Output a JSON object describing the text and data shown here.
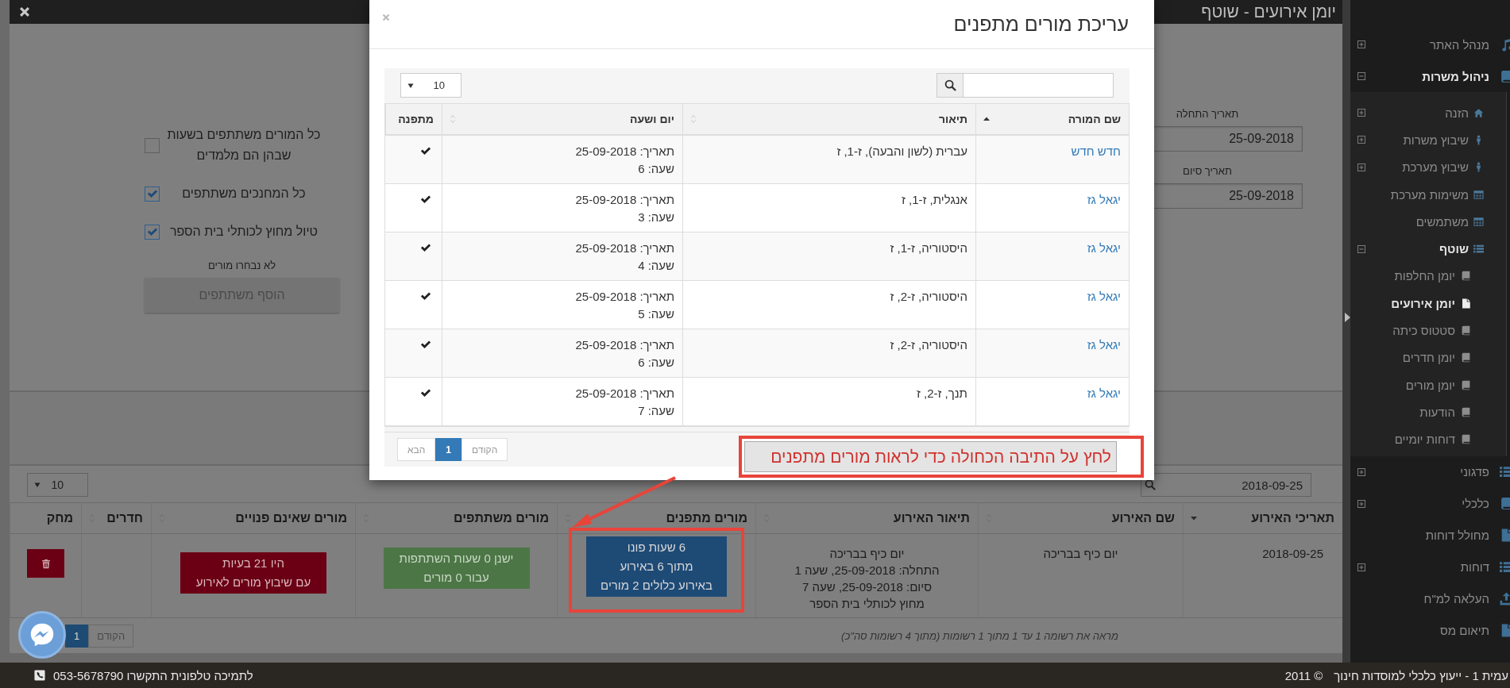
{
  "sidebar": {
    "items": [
      {
        "label": "מנהל האתר",
        "expanded": false,
        "selected": false
      },
      {
        "label": "ניהול משרות",
        "expanded": true,
        "selected": false,
        "children": [
          {
            "label": "הזנה",
            "expanded": false,
            "selected": false
          },
          {
            "label": "שיבוץ משרות",
            "expanded": false,
            "selected": false
          },
          {
            "label": "שיבוץ מערכת",
            "expanded": false,
            "selected": false
          },
          {
            "label": "משימות מערכת",
            "selected": false
          },
          {
            "label": "משתמשים",
            "selected": false
          },
          {
            "label": "שוטף",
            "expanded": true,
            "selected": false,
            "children": [
              {
                "label": "יומן החלפות",
                "selected": false
              },
              {
                "label": "יומן אירועים",
                "selected": true
              },
              {
                "label": "סטטוס כיתה",
                "selected": false
              },
              {
                "label": "יומן חדרים",
                "selected": false
              },
              {
                "label": "יומן מורים",
                "selected": false
              },
              {
                "label": "הודעות",
                "selected": false
              },
              {
                "label": "דוחות יומיים",
                "selected": false
              }
            ]
          }
        ]
      },
      {
        "label": "פדגוני",
        "expanded": false,
        "selected": false
      },
      {
        "label": "כלכלי",
        "expanded": false,
        "selected": false
      },
      {
        "label": "מחולל דוחות",
        "selected": false
      },
      {
        "label": "דוחות",
        "expanded": false,
        "selected": false
      },
      {
        "label": "העלאה למ\"ח",
        "selected": false
      },
      {
        "label": "תיאום מס",
        "selected": false
      }
    ]
  },
  "page": {
    "title": "יומן אירועים - שוטף"
  },
  "event_form": {
    "start_date": {
      "label": "תאריך התחלה",
      "value": "25-09-2018"
    },
    "end_date": {
      "label": "תאריך סיום",
      "value": "25-09-2018"
    },
    "options": [
      {
        "label": "כל המורים משתתפים בשעות שבהן הם מלמדים",
        "checked": false
      },
      {
        "label": "כל המחנכים משתתפים",
        "checked": true
      },
      {
        "label": "טיול מחוץ לכותלי בית הספר",
        "checked": true
      }
    ],
    "teachers_note": "לא נבחרו מורים",
    "add_button": {
      "label": "הוסף משתתפים",
      "disabled": true
    }
  },
  "events_table": {
    "page_size": "10",
    "search": "2018-09-25",
    "columns": [
      {
        "label": "תאריכי האירוע",
        "sortable": true,
        "sorted": true,
        "ascending": false
      },
      {
        "label": "שם האירוע",
        "sortable": true,
        "sorted": false
      },
      {
        "label": "תיאור האירוע",
        "sortable": true,
        "sorted": false
      },
      {
        "label": "מורים מתפנים",
        "sortable": true,
        "sorted": false
      },
      {
        "label": "מורים משתתפים",
        "sortable": true,
        "sorted": false
      },
      {
        "label": "מורים שאינם פנויים",
        "sortable": true,
        "sorted": false
      },
      {
        "label": "חדרים",
        "sortable": true,
        "sorted": false
      },
      {
        "label": "מחק",
        "sortable": false,
        "sorted": false
      }
    ],
    "rows": [
      {
        "date": "2018-09-25",
        "name": "יום כיף בבריכה",
        "description": [
          "יום כיף בבריכה",
          "התחלה: 25-09-2018, שעה 1",
          "סיום: 25-09-2018, שעה 7",
          "מחוץ לכותלי בית הספר"
        ],
        "freed": [
          "6 שעות פונו",
          "מתוך 6 באירוע",
          "באירוע כלולים 2 מורים"
        ],
        "participating": [
          "ישנן 0 שעות השתתפות",
          "עבור 0 מורים"
        ],
        "unavailable": [
          "היו 21 בעיות",
          "עם שיבוץ מורים לאירוע"
        ]
      }
    ],
    "info": "מראה את רשומה 1 עד 1 מתוך 1 רשומות (מתוך 4 רשומות סה\"כ)",
    "pagination": [
      {
        "label": "הקודם",
        "selected": false
      },
      {
        "label": "1",
        "selected": true
      }
    ]
  },
  "modal": {
    "title": "עריכת מורים מתפנים",
    "page_size": "10",
    "columns": [
      {
        "label": "שם המורה",
        "sortable": true,
        "sorted": true,
        "ascending": true
      },
      {
        "label": "תיאור",
        "sortable": true,
        "sorted": false
      },
      {
        "label": "יום ושעה",
        "sortable": true,
        "sorted": false
      },
      {
        "label": "מתפנה",
        "sortable": false,
        "sorted": false
      }
    ],
    "rows": [
      {
        "teacher": "חדש חדש",
        "description": "עברית (לשון והבעה), ז-1, ז",
        "date": "תאריך: 25-09-2018",
        "hour": "שעה: 6",
        "freed": true
      },
      {
        "teacher": "יגאל גז",
        "description": "אנגלית, ז-1, ז",
        "date": "תאריך: 25-09-2018",
        "hour": "שעה: 3",
        "freed": true
      },
      {
        "teacher": "יגאל גז",
        "description": "היסטוריה, ז-1, ז",
        "date": "תאריך: 25-09-2018",
        "hour": "שעה: 4",
        "freed": true
      },
      {
        "teacher": "יגאל גז",
        "description": "היסטוריה, ז-2, ז",
        "date": "תאריך: 25-09-2018",
        "hour": "שעה: 5",
        "freed": true
      },
      {
        "teacher": "יגאל גז",
        "description": "היסטוריה, ז-2, ז",
        "date": "תאריך: 25-09-2018",
        "hour": "שעה: 6",
        "freed": true
      },
      {
        "teacher": "יגאל גז",
        "description": "תנך, ז-2, ז",
        "date": "תאריך: 25-09-2018",
        "hour": "שעה: 7",
        "freed": true
      }
    ],
    "pagination": [
      {
        "label": "הקודם",
        "selected": false
      },
      {
        "label": "1",
        "selected": true
      },
      {
        "label": "הבא",
        "selected": false
      }
    ]
  },
  "annotation": {
    "text": "לחץ על התיבה הכחולה כדי לראות מורים מתפנים"
  },
  "footer": {
    "support": "לתמיכה טלפונית התקשרו 053-5678790",
    "company": "עמית 1 - ייעוץ כלכלי למוסדות חינוך",
    "copyright": "© 2011"
  }
}
